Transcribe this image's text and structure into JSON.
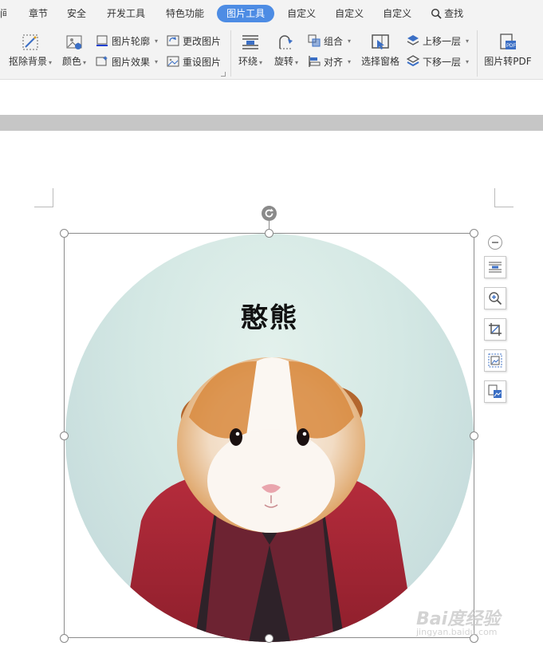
{
  "tabs": [
    {
      "label": "间",
      "active": false
    },
    {
      "label": "章节",
      "active": false
    },
    {
      "label": "安全",
      "active": false
    },
    {
      "label": "开发工具",
      "active": false
    },
    {
      "label": "特色功能",
      "active": false
    },
    {
      "label": "图片工具",
      "active": true
    },
    {
      "label": "自定义",
      "active": false
    },
    {
      "label": "自定义",
      "active": false
    },
    {
      "label": "自定义",
      "active": false
    }
  ],
  "search": {
    "label": "查找"
  },
  "ribbon": {
    "remove_bg": "抠除背景",
    "color": "颜色",
    "outline": "图片轮廓",
    "effect": "图片效果",
    "change_pic": "更改图片",
    "reset_pic": "重设图片",
    "wrap": "环绕",
    "rotate": "旋转",
    "group": "组合",
    "align": "对齐",
    "selection_pane": "选择窗格",
    "bring_forward": "上移一层",
    "send_backward": "下移一层",
    "pic_to_pdf": "图片转PDF"
  },
  "picture": {
    "caption": "憨熊"
  },
  "watermark": {
    "text": "Bai度经验",
    "sub": "jingyan.baidu.com"
  },
  "colors": {
    "accent": "#4d8ce4",
    "ribbon_bg": "#f3f3f3",
    "icon_blue": "#3b6fc5"
  }
}
